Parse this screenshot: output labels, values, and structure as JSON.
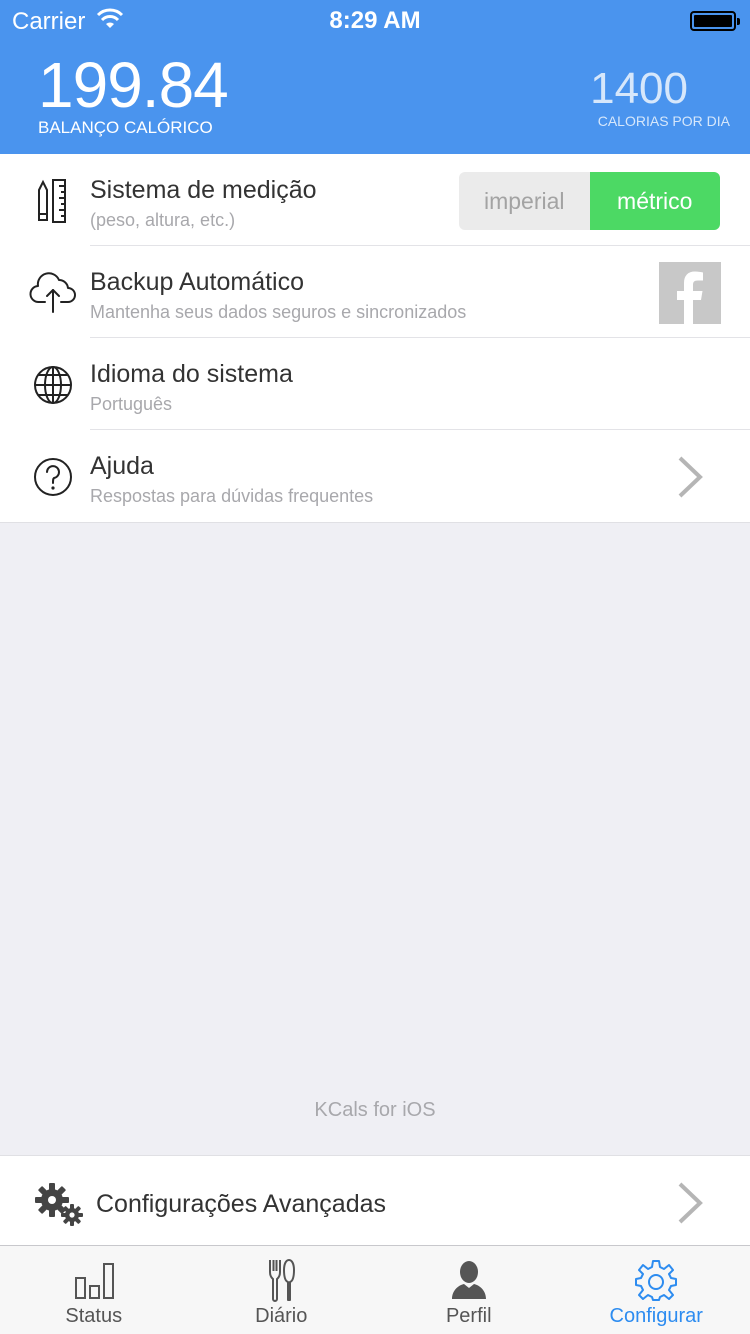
{
  "status_bar": {
    "carrier": "Carrier",
    "time": "8:29 AM",
    "battery_level": 1.0
  },
  "header": {
    "balance_value": "199.84",
    "balance_label": "BALANÇO CALÓRICO",
    "goal_value": "1400",
    "goal_label": "CALORIAS POR DIA",
    "background_color": "#4a94ee"
  },
  "settings": {
    "items": [
      {
        "title": "Sistema de medição",
        "subtitle": "(peso, altura, etc.)",
        "icon": "ruler-pencil-icon",
        "options": [
          "imperial",
          "métrico"
        ],
        "selected": "métrico"
      },
      {
        "title": "Backup Automático",
        "subtitle": "Mantenha seus dados seguros e sincronizados",
        "icon": "cloud-upload-icon",
        "action_icon": "facebook-icon"
      },
      {
        "title": "Idioma do sistema",
        "subtitle": "Português",
        "icon": "globe-icon"
      },
      {
        "title": "Ajuda",
        "subtitle": "Respostas para dúvidas frequentes",
        "icon": "question-icon",
        "action_icon": "chevron-right-icon"
      }
    ],
    "selected_color": "#4cd964"
  },
  "footer_text": "KCals for iOS",
  "advanced": {
    "label": "Configurações Avançadas",
    "icon": "gears-icon"
  },
  "tabbar": {
    "tabs": [
      {
        "label": "Status",
        "icon": "bar-chart-icon"
      },
      {
        "label": "Diário",
        "icon": "fork-knife-icon"
      },
      {
        "label": "Perfil",
        "icon": "person-icon"
      },
      {
        "label": "Configurar",
        "icon": "gear-icon"
      }
    ],
    "active_tab": "Configurar",
    "active_color": "#2d8cf0"
  }
}
